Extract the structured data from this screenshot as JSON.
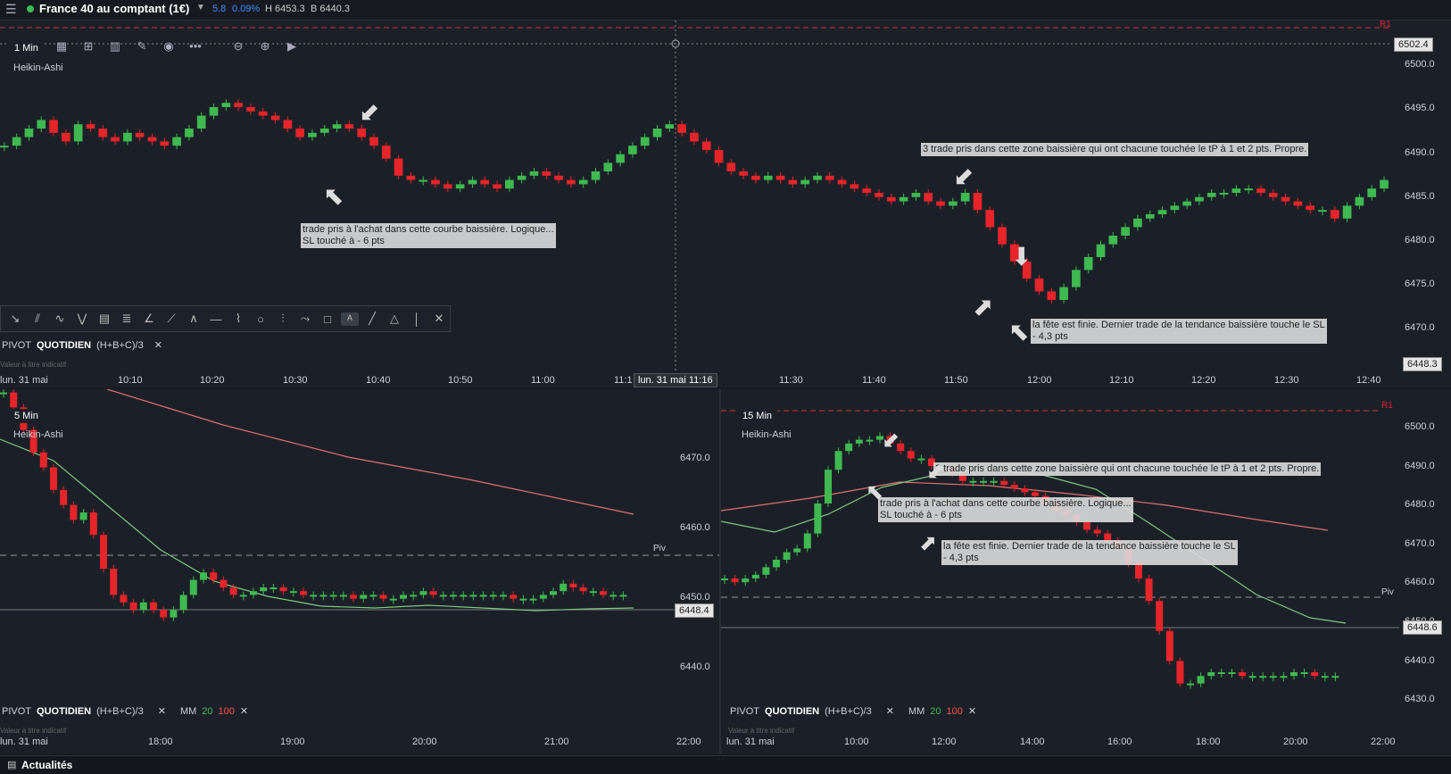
{
  "header": {
    "menu_icon": "hamburger-icon",
    "instrument": "France 40 au comptant (1€)",
    "change": "5.8",
    "change_pct": "0.09%",
    "high": "H 6453.3",
    "low": "B 6440.3"
  },
  "top_chart": {
    "timeframe": "1 Min",
    "style": "Heikin-Ashi",
    "y_labels": [
      "6500.0",
      "6495.0",
      "6490.0",
      "6485.0",
      "6480.0",
      "6475.0",
      "6470.0"
    ],
    "price_tag": "6502.4",
    "last_tag": "6448.3",
    "marker": "R1",
    "x_labels": [
      "lun. 31 mai",
      "10:10",
      "10:20",
      "10:30",
      "10:40",
      "10:50",
      "11:00",
      "11:1",
      "11:30",
      "11:40",
      "11:50",
      "12:00",
      "12:10",
      "12:20",
      "12:30",
      "12:40"
    ],
    "crosshair_label": "lun. 31 mai 11:16",
    "legend": {
      "pivot": "PIVOT",
      "period": "QUOTIDIEN",
      "formula": "(H+B+C)/3",
      "note": "Valeur à titre indicatif"
    },
    "notes": [
      "trade pris à l'achat dans cette courbe baissière. Logique...\nSL touché à - 6 pts",
      "3 trade pris dans cette zone baissière qui ont chacune touchée le tP à 1 et 2 pts. Propre.",
      "la fête est finie. Dernier trade de la tendance baissière touche le SL\n- 4,3 pts"
    ],
    "candles": [
      0.1,
      0.3,
      0.5,
      0.7,
      0.4,
      0.2,
      0.6,
      0.5,
      0.3,
      0.2,
      0.4,
      0.3,
      0.2,
      0.1,
      0.3,
      0.5,
      0.8,
      1.0,
      1.1,
      1.0,
      0.9,
      0.8,
      0.7,
      0.5,
      0.3,
      0.4,
      0.5,
      0.6,
      0.5,
      0.3,
      0.1,
      -0.2,
      -0.6,
      -0.7,
      -0.7,
      -0.8,
      -0.9,
      -0.8,
      -0.7,
      -0.8,
      -0.9,
      -0.7,
      -0.6,
      -0.5,
      -0.6,
      -0.7,
      -0.8,
      -0.7,
      -0.5,
      -0.3,
      -0.1,
      0.1,
      0.3,
      0.5,
      0.6,
      0.4,
      0.2,
      0.0,
      -0.3,
      -0.5,
      -0.6,
      -0.7,
      -0.6,
      -0.7,
      -0.8,
      -0.7,
      -0.6,
      -0.7,
      -0.8,
      -0.9,
      -1.0,
      -1.1,
      -1.2,
      -1.1,
      -1.0,
      -1.2,
      -1.3,
      -1.2,
      -1.0,
      -1.4,
      -1.8,
      -2.2,
      -2.6,
      -3.0,
      -3.3,
      -3.5,
      -3.2,
      -2.8,
      -2.5,
      -2.2,
      -2.0,
      -1.8,
      -1.6,
      -1.5,
      -1.4,
      -1.3,
      -1.2,
      -1.1,
      -1.0,
      -1.0,
      -0.9,
      -0.9,
      -1.0,
      -1.1,
      -1.2,
      -1.3,
      -1.4,
      -1.4,
      -1.6,
      -1.3,
      -1.1,
      -0.9,
      -0.7
    ]
  },
  "bottom_left": {
    "timeframe": "5 Min",
    "style": "Heikin-Ashi",
    "y_labels": [
      "6470.0",
      "6460.0",
      "6450.0",
      "6440.0"
    ],
    "pivot_label": "Piv",
    "last_tag": "6448.4",
    "x_labels": [
      "lun. 31 mai",
      "18:00",
      "19:00",
      "20:00",
      "21:00",
      "22:00"
    ],
    "legend": {
      "pivot": "PIVOT",
      "period": "QUOTIDIEN",
      "formula": "(H+B+C)/3",
      "ma": "MM",
      "ma1": "20",
      "ma2": "100",
      "note": "Valeur à titre indicatif"
    }
  },
  "bottom_right": {
    "timeframe": "15 Min",
    "style": "Heikin-Ashi",
    "marker": "R1",
    "y_labels": [
      "6500.0",
      "6490.0",
      "6480.0",
      "6470.0",
      "6460.0",
      "6450.0",
      "6440.0",
      "6430.0"
    ],
    "pivot_label": "Piv",
    "last_tag": "6448.6",
    "x_labels": [
      "lun. 31 mai",
      "10:00",
      "12:00",
      "14:00",
      "16:00",
      "18:00",
      "20:00",
      "22:00"
    ],
    "legend": {
      "pivot": "PIVOT",
      "period": "QUOTIDIEN",
      "formula": "(H+B+C)/3",
      "ma": "MM",
      "ma1": "20",
      "ma2": "100",
      "note": "Valeur à titre indicatif"
    },
    "notes": [
      "3 trade pris dans cette zone baissière qui ont chacune touchée le tP à 1 et 2 pts. Propre.",
      "trade pris à l'achat dans cette courbe baissière. Logique...\nSL touché à - 6 pts",
      "la fête est finie. Dernier trade de la tendance baissière touche le SL\n- 4,3 pts"
    ]
  },
  "footer": {
    "label": "Actualités"
  },
  "colors": {
    "up": "#3fb950",
    "down": "#e5252a",
    "bg": "#1b2028"
  }
}
